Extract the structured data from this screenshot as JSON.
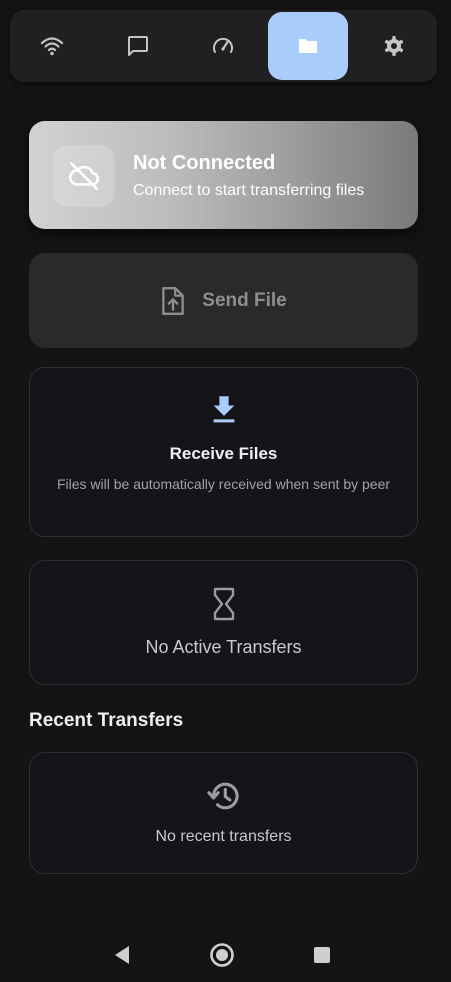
{
  "tabs": [
    {
      "icon": "wifi-icon",
      "active": false
    },
    {
      "icon": "chat-icon",
      "active": false
    },
    {
      "icon": "speed-icon",
      "active": false
    },
    {
      "icon": "folder-icon",
      "active": true
    },
    {
      "icon": "gear-icon",
      "active": false
    }
  ],
  "status": {
    "title": "Not Connected",
    "subtitle": "Connect to start transferring files",
    "icon": "cloud-off-icon"
  },
  "send": {
    "label": "Send File",
    "icon": "file-upload-icon"
  },
  "receive": {
    "title": "Receive Files",
    "description": "Files will be automatically received when sent by peer",
    "icon": "download-icon"
  },
  "active_transfers": {
    "label": "No Active Transfers",
    "icon": "hourglass-icon"
  },
  "recent": {
    "section_title": "Recent Transfers",
    "empty_label": "No recent transfers",
    "icon": "history-icon"
  },
  "system_nav": [
    "back-icon",
    "home-icon",
    "recents-icon"
  ],
  "colors": {
    "accent": "#a9cdfb",
    "background": "#141414"
  }
}
